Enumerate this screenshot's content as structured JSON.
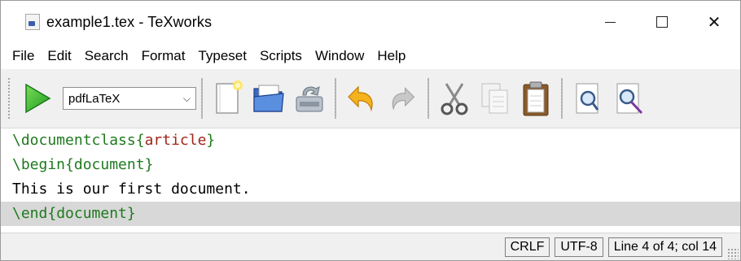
{
  "window": {
    "title": "example1.tex - TeXworks",
    "app_icon": "tex-document-icon"
  },
  "menu": {
    "items": [
      "File",
      "Edit",
      "Search",
      "Format",
      "Typeset",
      "Scripts",
      "Window",
      "Help"
    ]
  },
  "toolbar": {
    "typeset_engine": "pdfLaTeX",
    "icons": [
      "typeset-play-icon",
      "new-document-icon",
      "open-folder-icon",
      "save-icon",
      "undo-icon",
      "redo-icon",
      "cut-scissors-icon",
      "copy-icon",
      "paste-clipboard-icon",
      "find-icon",
      "replace-icon"
    ]
  },
  "editor": {
    "lines": {
      "l1_cmd": "\\documentclass",
      "l1_open": "{",
      "l1_arg": "article",
      "l1_close": "}",
      "l2_cmd": "\\begin",
      "l2_arg": "{document}",
      "l3_text": "This is our first document.",
      "l4_cmd": "\\end",
      "l4_arg": "{document}"
    },
    "current_line": 4
  },
  "status": {
    "line_ending": "CRLF",
    "encoding": "UTF-8",
    "position": "Line 4 of 4; col 14"
  },
  "colors": {
    "command": "#1e7a1e",
    "argument_red": "#a1261a",
    "current_line_bg": "#d8d8d8"
  }
}
